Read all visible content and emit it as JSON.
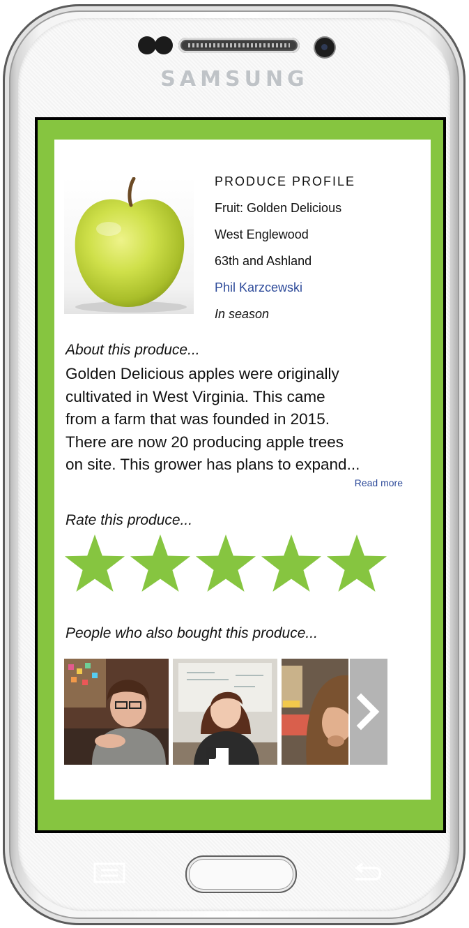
{
  "device": {
    "brand": "SAMSUNG"
  },
  "profile": {
    "heading": "PRODUCE PROFILE",
    "fruit": "Fruit: Golden Delicious",
    "neighborhood": "West Englewood",
    "location": "63th and Ashland",
    "grower": "Phil Karzcewski",
    "season": "In season"
  },
  "about": {
    "heading": "About this produce...",
    "lines": [
      "Golden Delicious apples were originally",
      "cultivated in West Virginia. This came",
      "from a farm that was founded in 2015.",
      "There are now 20 producing apple trees",
      "on site. This grower has plans to expand..."
    ],
    "read_more": "Read more"
  },
  "rating": {
    "heading": "Rate this produce...",
    "max": 5,
    "value": 5,
    "star_color": "#86c540"
  },
  "people": {
    "heading": "People who also bought this produce..."
  },
  "colors": {
    "accent_green": "#86c540",
    "link_blue": "#2e4b9a"
  }
}
